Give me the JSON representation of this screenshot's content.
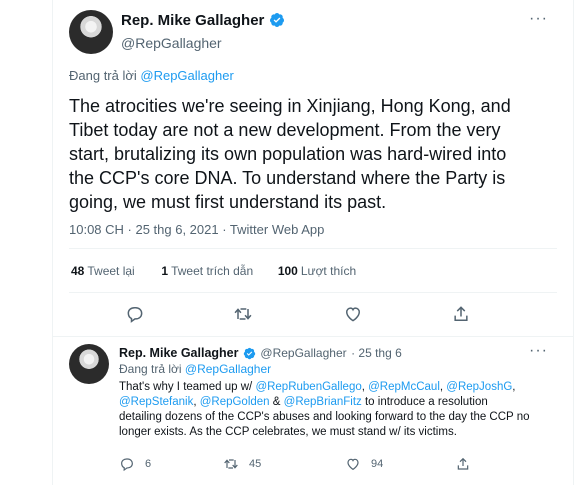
{
  "main_tweet": {
    "name": "Rep. Mike Gallagher",
    "handle": "@RepGallagher",
    "reply_prefix": "Đang trả lời ",
    "reply_handle": "@RepGallagher",
    "text": "The atrocities we're seeing in Xinjiang, Hong Kong, and Tibet today are not a new development. From the very start, brutalizing its own population was hard-wired into the CCP's core DNA. To understand where the Party is going, we must first understand its past.",
    "timestamp": "10:08 CH · 25 thg 6, 2021 · Twitter Web App",
    "stats": {
      "retweets_count": "48",
      "retweets_label": "Tweet lại",
      "quotes_count": "1",
      "quotes_label": "Tweet trích dẫn",
      "likes_count": "100",
      "likes_label": "Lượt thích"
    }
  },
  "reply_tweet": {
    "name": "Rep. Mike Gallagher",
    "handle": "@RepGallagher",
    "date": "· 25 thg 6",
    "reply_prefix": "Đang trả lời ",
    "reply_handle": "@RepGallagher",
    "text_part1": "That's why I teamed up w/ ",
    "mention1": "@RepRubenGallego",
    "sep1": ", ",
    "mention2": "@RepMcCaul",
    "sep2": ", ",
    "mention3": "@RepJoshG",
    "sep3": ", ",
    "mention4": "@RepStefanik",
    "sep4": ", ",
    "mention5": "@RepGolden",
    "sep5": " & ",
    "mention6": "@RepBrianFitz",
    "text_part2": " to introduce a resolution detailing dozens of the CCP's abuses and looking forward to the day the CCP no longer exists. As the CCP celebrates, we must stand w/ its victims.",
    "replies": "6",
    "retweets": "45",
    "likes": "94"
  },
  "colors": {
    "accent": "#1d9bf0",
    "text": "#0f1419",
    "secondary": "#536471",
    "divider": "#eff3f4"
  },
  "icons": [
    "verified-badge-icon",
    "more-options-icon",
    "reply-icon",
    "retweet-icon",
    "like-icon",
    "share-icon"
  ]
}
